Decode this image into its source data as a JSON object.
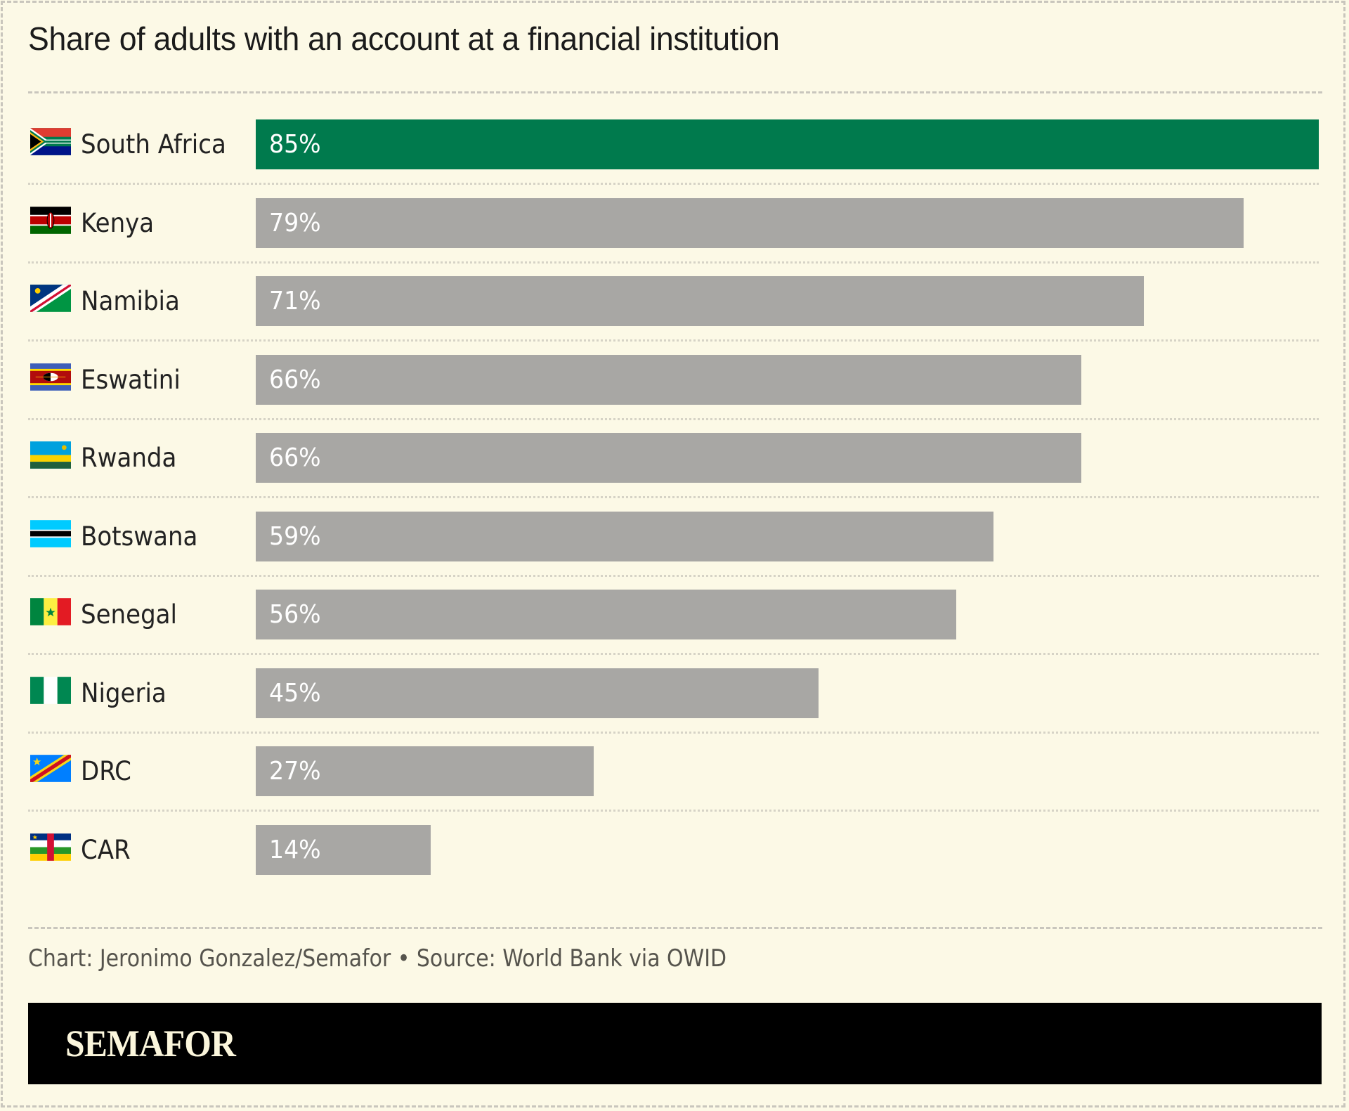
{
  "header": {
    "title": "Share of adults with an account at a financial institution"
  },
  "colors": {
    "background": "#fcf9e6",
    "highlight_bar": "#007a4d",
    "default_bar": "#a8a7a4",
    "bar_label": "#ffffff",
    "banner": "#000000",
    "brand_text": "#fbf6dc"
  },
  "chart_data": {
    "type": "bar",
    "orientation": "horizontal",
    "title": "Share of adults with an account at a financial institution",
    "xlabel": "",
    "ylabel": "",
    "unit": "%",
    "xlim": [
      0,
      85
    ],
    "grid": false,
    "legend": "none",
    "highlight": "South Africa",
    "categories": [
      "South Africa",
      "Kenya",
      "Namibia",
      "Eswatini",
      "Rwanda",
      "Botswana",
      "Senegal",
      "Nigeria",
      "DRC",
      "CAR"
    ],
    "values": [
      85,
      79,
      71,
      66,
      66,
      59,
      56,
      45,
      27,
      14
    ],
    "labels": [
      "85%",
      "79%",
      "71%",
      "66%",
      "66%",
      "59%",
      "56%",
      "45%",
      "27%",
      "14%"
    ],
    "flags": [
      "flag-south-africa-icon",
      "flag-kenya-icon",
      "flag-namibia-icon",
      "flag-eswatini-icon",
      "flag-rwanda-icon",
      "flag-botswana-icon",
      "flag-senegal-icon",
      "flag-nigeria-icon",
      "flag-drc-icon",
      "flag-car-icon"
    ]
  },
  "footer": {
    "credit": "Chart: Jeronimo Gonzalez/Semafor • Source: World Bank via OWID",
    "brand": "SEMAFOR"
  }
}
